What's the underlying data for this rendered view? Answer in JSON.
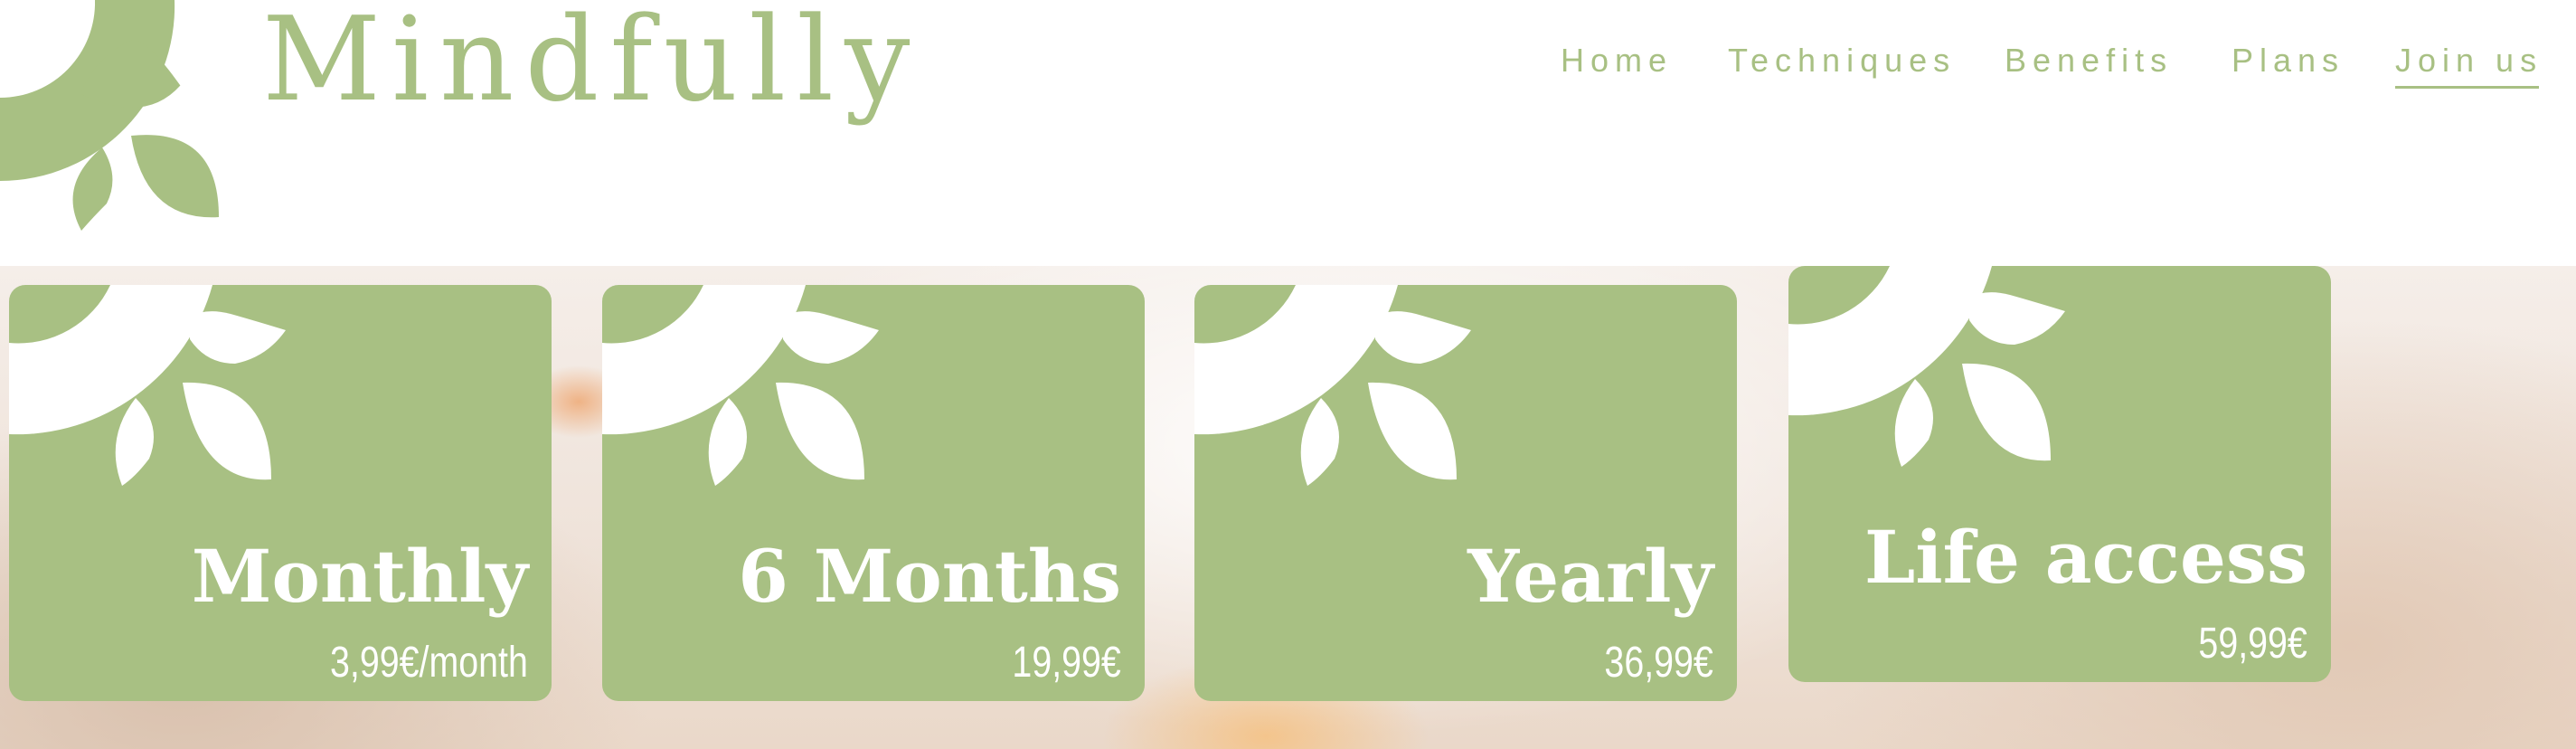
{
  "brand": {
    "name": "Mindfully",
    "logo_icon": "sun-leaves-icon"
  },
  "nav": {
    "items": [
      {
        "label": "Home",
        "active": false
      },
      {
        "label": "Techniques",
        "active": false
      },
      {
        "label": "Benefits",
        "active": false
      },
      {
        "label": "Plans",
        "active": false
      },
      {
        "label": "Join us",
        "active": true
      }
    ]
  },
  "plans": [
    {
      "name": "Monthly",
      "price": "3,99€/month"
    },
    {
      "name": "6 Months",
      "price": "19,99€"
    },
    {
      "name": "Yearly",
      "price": "36,99€"
    },
    {
      "name": "Life access",
      "price": "59,99€"
    }
  ],
  "colors": {
    "accent": "#a8c083",
    "text_on_accent": "#ffffff",
    "background": "#ffffff"
  }
}
